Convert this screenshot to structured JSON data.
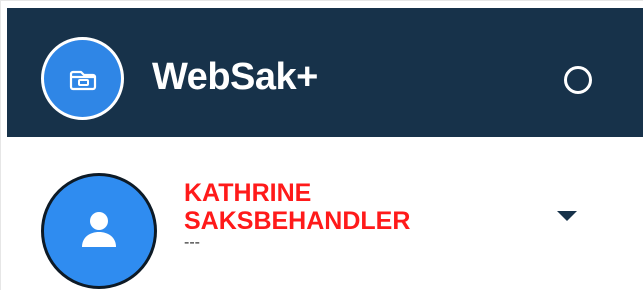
{
  "header": {
    "app_title": "WebSak+",
    "logo_icon": "folder-icon",
    "status_icon": "circle-outline-icon",
    "background_color": "#17324a",
    "accent_color": "#2f86e6"
  },
  "user": {
    "name_line1": "KATHRINE",
    "name_line2": "SAKSBEHANDLER",
    "subtitle": "---",
    "avatar_icon": "person-icon",
    "menu_icon": "caret-down-icon",
    "name_color": "#ff1a1a"
  }
}
